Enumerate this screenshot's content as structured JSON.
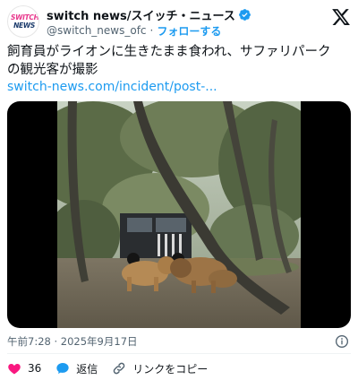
{
  "account": {
    "display_name": "switch news/スイッチ・ニュース",
    "handle": "@switch_news_ofc",
    "separator": "·",
    "follow_label": "フォローする",
    "avatar_line1": "SWITCH",
    "avatar_line2": "NEWS",
    "verified_color": "#1d9bf0"
  },
  "tweet": {
    "text_line1": "飼育員がライオンに生きたまま食われ、サファリパーク",
    "text_line2": "の観光客が撮影",
    "link": "switch-news.com/incident/post-..."
  },
  "media": {
    "type": "video",
    "description_icon": "video-thumbnail"
  },
  "meta": {
    "timestamp": "午前7:28 · 2025年9月17日"
  },
  "actions": {
    "like_count": "36",
    "reply_label": "返信",
    "copy_link_label": "リンクをコピー",
    "like_color": "#f91880",
    "reply_color": "#1d9bf0"
  }
}
